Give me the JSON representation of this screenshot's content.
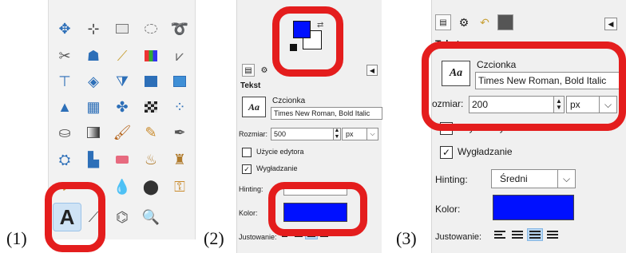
{
  "labels": {
    "p1": "(1)",
    "p2": "(2)",
    "p3": "(3)"
  },
  "panel2": {
    "section_title": "Tekst",
    "font_label": "Czcionka",
    "font_value": "Times New Roman, Bold Italic",
    "font_preview": "Aa",
    "size_label": "Rozmiar:",
    "size_value": "500",
    "unit_value": "px",
    "editor_label": "Użycie edytora",
    "antialias_label": "Wygładzanie",
    "hinting_label": "Hinting:",
    "color_label": "Kolor:",
    "justify_label": "Justowanie:",
    "color_hex": "#0010ff"
  },
  "panel3": {
    "section_title": "Tekst",
    "font_label": "Czcionka",
    "font_value": "Times New Roman, Bold Italic",
    "font_preview": "Aa",
    "size_label": "ozmiar:",
    "size_value": "200",
    "unit_value": "px",
    "editor_label": "Użycie edytora",
    "antialias_label": "Wygładzanie",
    "hinting_label": "Hinting:",
    "hinting_value": "Średni",
    "color_label": "Kolor:",
    "justify_label": "Justowanie:",
    "color_hex": "#0010ff"
  },
  "toolbox": {
    "tools": [
      "move",
      "align",
      "rect-select",
      "ellipse-select",
      "free-select",
      "scissors-select",
      "foreground-select",
      "fuzzy-select",
      "color-select",
      "paths",
      "crop",
      "unified-transform",
      "perspective",
      "flip",
      "cage-transform",
      "warp",
      "grid-transform",
      "shear",
      "checker",
      "handle-transform",
      "bucket-fill",
      "gradient",
      "paintbrush",
      "pencil",
      "ink",
      "clone",
      "heal",
      "eraser",
      "smudge",
      "stamp",
      "dodge",
      "blur",
      "measure",
      "color-picker",
      "text",
      "zoom"
    ],
    "selected": "text"
  },
  "annotation_color": "#e41d1d"
}
